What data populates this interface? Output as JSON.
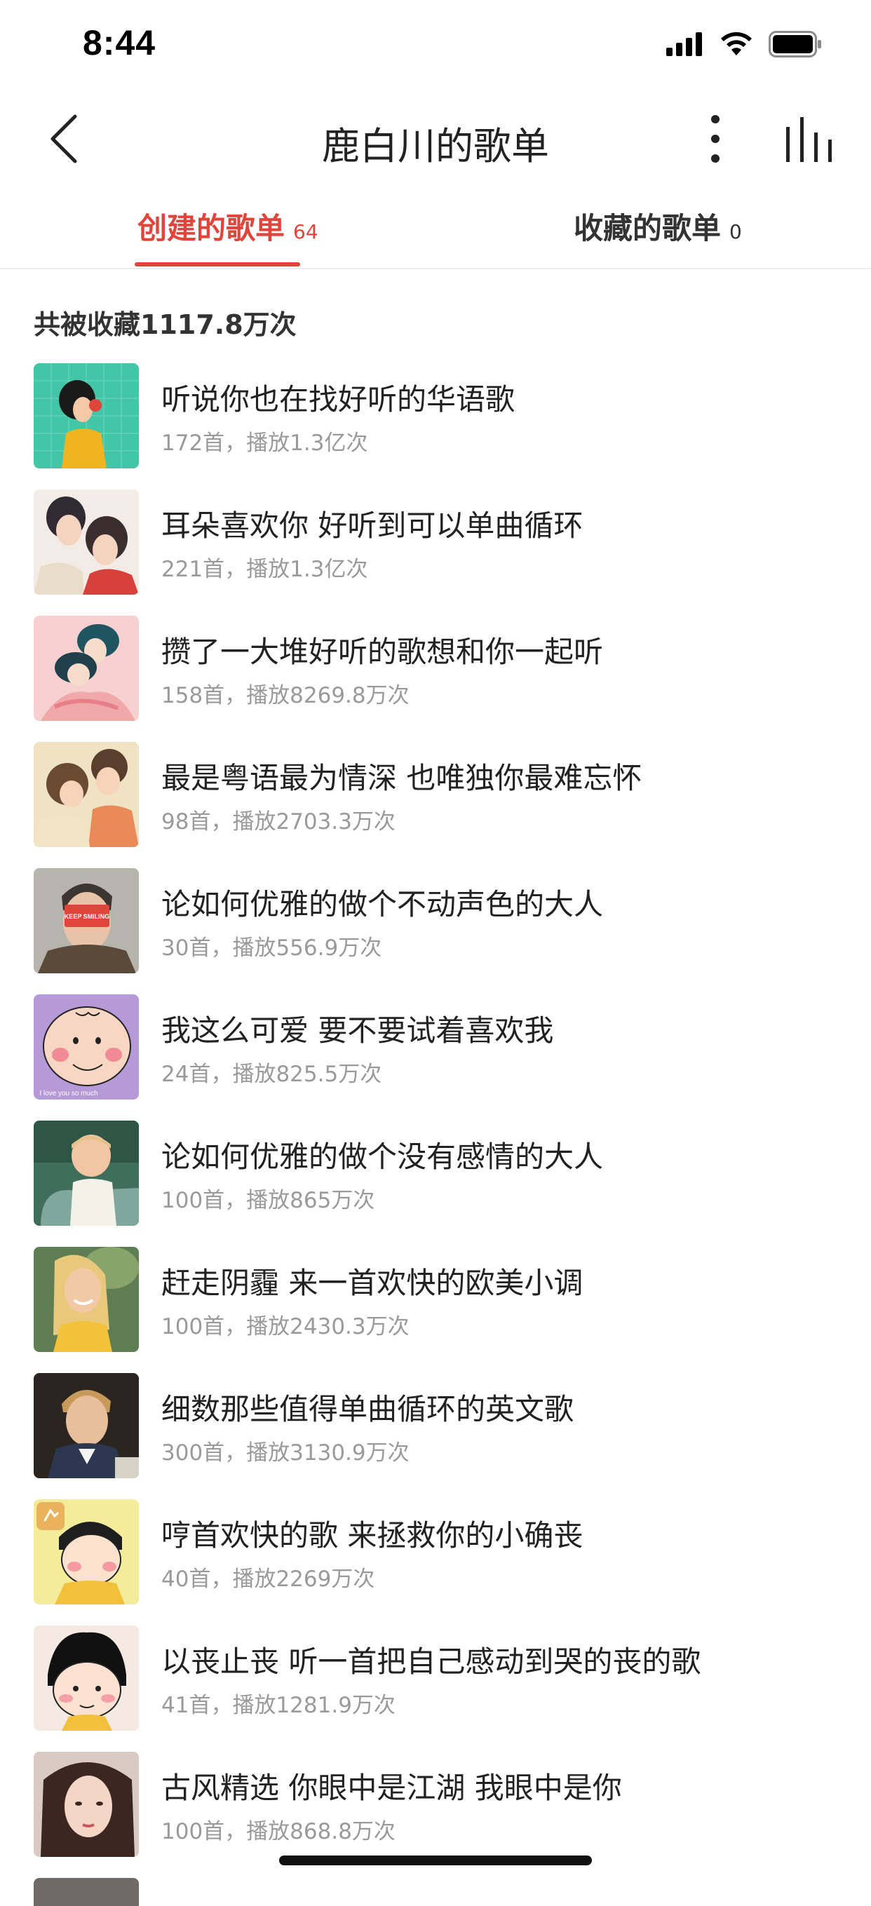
{
  "status_bar": {
    "time": "8:44",
    "icons": [
      "cellular-signal-icon",
      "wifi-icon",
      "battery-icon"
    ]
  },
  "nav": {
    "title": "鹿白川的歌单",
    "icons": [
      "back-arrow-icon",
      "more-vertical-icon",
      "playing-bars-icon"
    ]
  },
  "tabs": [
    {
      "label": "创建的歌单",
      "count": "64",
      "active": true
    },
    {
      "label": "收藏的歌单",
      "count": "0",
      "active": false
    }
  ],
  "colors": {
    "accent": "#e0453c",
    "text": "#222222",
    "meta": "#9a9a9a"
  },
  "summary": "共被收藏1117.8万次",
  "playlists": [
    {
      "title": "听说你也在找好听的华语歌",
      "meta": "172首，播放1.3亿次"
    },
    {
      "title": "耳朵喜欢你 好听到可以单曲循环",
      "meta": "221首，播放1.3亿次"
    },
    {
      "title": "攒了一大堆好听的歌想和你一起听",
      "meta": "158首，播放8269.8万次"
    },
    {
      "title": "最是粤语最为情深 也唯独你最难忘怀",
      "meta": "98首，播放2703.3万次"
    },
    {
      "title": "论如何优雅的做个不动声色的大人",
      "meta": "30首，播放556.9万次",
      "cover_text": "KEEP SMILING"
    },
    {
      "title": "我这么可爱 要不要试着喜欢我",
      "meta": "24首，播放825.5万次",
      "cover_text": "I love you so much"
    },
    {
      "title": "论如何优雅的做个没有感情的大人",
      "meta": "100首，播放865万次"
    },
    {
      "title": "赶走阴霾 来一首欢快的欧美小调",
      "meta": "100首，播放2430.3万次"
    },
    {
      "title": "细数那些值得单曲循环的英文歌",
      "meta": "300首，播放3130.9万次"
    },
    {
      "title": "哼首欢快的歌 来拯救你的小确丧",
      "meta": "40首，播放2269万次"
    },
    {
      "title": "以丧止丧 听一首把自己感动到哭的丧的歌",
      "meta": "41首，播放1281.9万次"
    },
    {
      "title": "古风精选 你眼中是江湖 我眼中是你",
      "meta": "100首，播放868.8万次"
    }
  ]
}
